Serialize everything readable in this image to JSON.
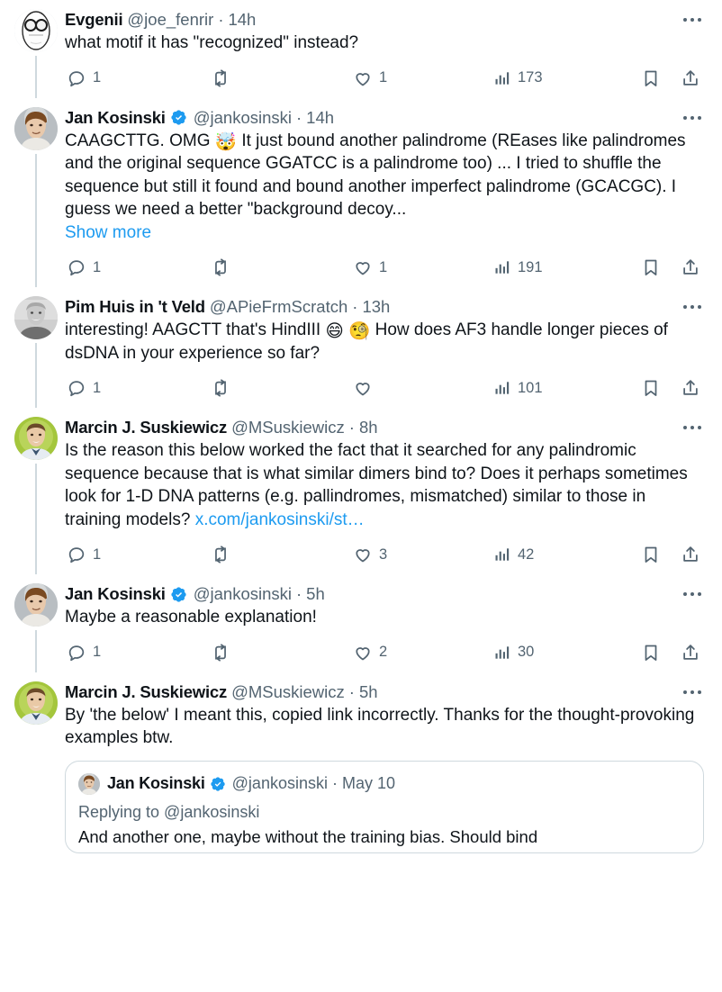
{
  "accent": "#1d9bf0",
  "text_color": "#0f1419",
  "muted_color": "#536471",
  "border_color": "#cfd9de",
  "icons": {
    "reply": "reply-icon",
    "retweet": "retweet-icon",
    "like": "like-heart-icon",
    "views": "views-bar-chart-icon",
    "bookmark": "bookmark-icon",
    "share": "share-icon",
    "more": "more-options-icon",
    "verified": "verified-badge-icon"
  },
  "tweets": [
    {
      "display_name": "Evgenii",
      "verified": false,
      "handle": "@joe_fenrir",
      "separator": "·",
      "time": "14h",
      "avatar": "cartoon-face-glasses",
      "text": "what motif it has \"recognized\" instead?",
      "show_more": null,
      "actions": {
        "reply_count": "1",
        "retweet_count": "",
        "like_count": "1",
        "view_count": "173"
      }
    },
    {
      "display_name": "Jan Kosinski",
      "verified": true,
      "handle": "@jankosinski",
      "separator": "·",
      "time": "14h",
      "avatar": "photo-jan",
      "text_parts": [
        {
          "t": "CAAGCTTG. OMG "
        },
        {
          "emoji": "🤯"
        },
        {
          "t": " It just bound another palindrome (REases like palindromes and the original sequence GGATCC is a palindrome too) ... I tried to shuffle the sequence but still it found and bound another imperfect palindrome (GCACGC). I guess we need a better \"background decoy..."
        }
      ],
      "show_more": "Show more",
      "actions": {
        "reply_count": "1",
        "retweet_count": "",
        "like_count": "1",
        "view_count": "191"
      }
    },
    {
      "display_name": "Pim Huis in 't Veld",
      "verified": false,
      "handle": "@APieFrmScratch",
      "separator": "·",
      "time": "13h",
      "avatar": "photo-pim",
      "text_parts": [
        {
          "t": "interesting! AAGCTT that's HindIII "
        },
        {
          "emoji": "😄"
        },
        {
          "t": " "
        },
        {
          "emoji": "🧐"
        },
        {
          "t": " How does AF3 handle longer pieces of dsDNA in your experience so far?"
        }
      ],
      "show_more": null,
      "actions": {
        "reply_count": "1",
        "retweet_count": "",
        "like_count": "",
        "view_count": "101"
      }
    },
    {
      "display_name": "Marcin J. Suskiewicz",
      "verified": false,
      "handle": "@MSuskiewicz",
      "separator": "·",
      "time": "8h",
      "avatar": "photo-marcin",
      "text_parts": [
        {
          "t": "Is the reason this below worked the fact that it searched for any palindromic sequence because that is what similar dimers bind to? Does it perhaps sometimes look for 1-D DNA patterns (e.g. pallindromes, mismatched) similar to those in training models? "
        },
        {
          "link": "x.com/jankosinski/st…"
        }
      ],
      "show_more": null,
      "actions": {
        "reply_count": "1",
        "retweet_count": "",
        "like_count": "3",
        "view_count": "42"
      }
    },
    {
      "display_name": "Jan Kosinski",
      "verified": true,
      "handle": "@jankosinski",
      "separator": "·",
      "time": "5h",
      "avatar": "photo-jan",
      "text": "Maybe a reasonable explanation!",
      "show_more": null,
      "actions": {
        "reply_count": "1",
        "retweet_count": "",
        "like_count": "2",
        "view_count": "30"
      }
    },
    {
      "display_name": "Marcin J. Suskiewicz",
      "verified": false,
      "handle": "@MSuskiewicz",
      "separator": "·",
      "time": "5h",
      "avatar": "photo-marcin",
      "text": "By 'the below' I meant this, copied link incorrectly. Thanks for the thought-provoking examples btw.",
      "show_more": null,
      "quote": {
        "display_name": "Jan Kosinski",
        "verified": true,
        "handle": "@jankosinski",
        "separator": "·",
        "time": "May 10",
        "avatar": "photo-jan",
        "replying_to": "Replying to @jankosinski",
        "text": "And another one, maybe without the training bias. Should bind"
      },
      "actions": null
    }
  ]
}
